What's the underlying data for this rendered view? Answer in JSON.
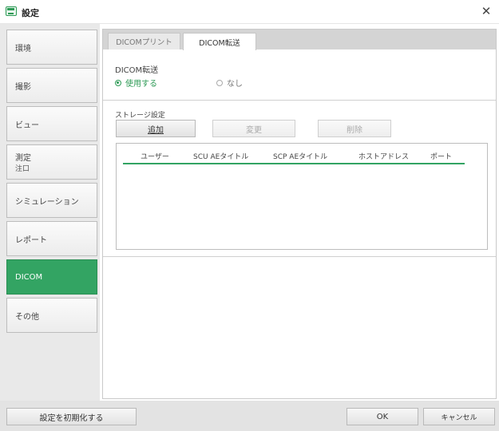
{
  "window": {
    "title": "設定"
  },
  "sidebar": {
    "items": [
      {
        "label": "環境"
      },
      {
        "label": "撮影"
      },
      {
        "label": "ビュー"
      },
      {
        "label": "測定",
        "sublabel": "注口"
      },
      {
        "label": "シミュレーション"
      },
      {
        "label": "レポート"
      },
      {
        "label": "DICOM",
        "active": true
      },
      {
        "label": "その他"
      }
    ]
  },
  "tabs": [
    {
      "label": "DICOMプリント",
      "active": false
    },
    {
      "label": "DICOM転送",
      "active": true
    }
  ],
  "transfer": {
    "section_label": "DICOM転送",
    "option_use": "使用する",
    "option_none": "なし",
    "selected": "使用する"
  },
  "storage": {
    "section_label": "ストレージ設定",
    "add_label": "追加",
    "change_label": "変更",
    "delete_label": "削除",
    "columns": [
      "ユーザー",
      "SCU AEタイトル",
      "SCP AEタイトル",
      "ホストアドレス",
      "ポート"
    ],
    "rows": []
  },
  "footer": {
    "reset_label": "設定を初期化する",
    "ok_label": "OK",
    "cancel_label": "キャンセル"
  },
  "colors": {
    "accent": "#33a463"
  },
  "icons": {
    "app": "settings-app-icon",
    "close": "close-icon"
  }
}
